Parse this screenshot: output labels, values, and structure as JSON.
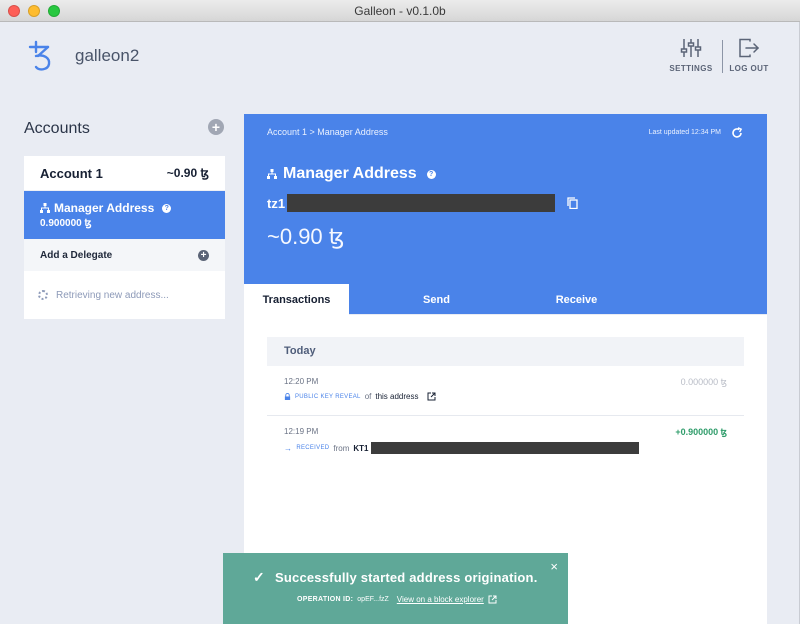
{
  "window": {
    "title": "Galleon - v0.1.0b"
  },
  "header": {
    "wallet_name": "galleon2",
    "settings_label": "SETTINGS",
    "logout_label": "LOG OUT"
  },
  "sidebar": {
    "accounts_title": "Accounts",
    "add_icon": "+",
    "account": {
      "name": "Account 1",
      "balance": "~0.90 ꜩ"
    },
    "manager": {
      "label": "Manager Address",
      "balance": "0.900000 ꜩ",
      "help": "?"
    },
    "delegate": {
      "label": "Add a Delegate",
      "add_icon": "+"
    },
    "retrieving": "Retrieving new address..."
  },
  "main": {
    "breadcrumb": "Account 1 > Manager Address",
    "last_updated": "Last updated 12:34 PM",
    "title": "Manager Address",
    "help": "?",
    "address_prefix": "tz1",
    "balance": "~0.90 ꜩ",
    "tabs": [
      {
        "label": "Transactions"
      },
      {
        "label": "Send"
      },
      {
        "label": "Receive"
      }
    ],
    "day": "Today",
    "transactions": [
      {
        "time": "12:20 PM",
        "amount": "0.000000 ꜩ",
        "tag": "PUBLIC KEY REVEAL",
        "connector": "of",
        "target": "this address"
      },
      {
        "time": "12:19 PM",
        "amount": "+0.900000 ꜩ",
        "tag": "RECEIVED",
        "connector": "from",
        "target": "KT1"
      }
    ]
  },
  "toast": {
    "check": "✓",
    "message": "Successfully started address origination.",
    "close": "×",
    "op_label": "OPERATION ID:",
    "op_value": "opEF...fzZ",
    "link": "View on a block explorer"
  },
  "colors": {
    "accent": "#4a83e9",
    "toast": "#5fa898",
    "positive": "#2e9c6a",
    "muted": "#b8bcc6"
  }
}
